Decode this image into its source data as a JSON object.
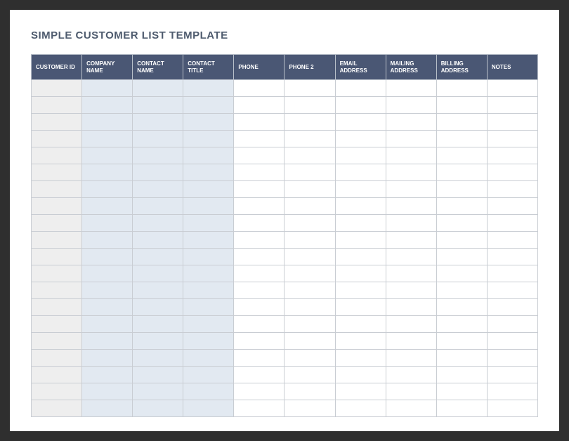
{
  "title": "SIMPLE CUSTOMER LIST TEMPLATE",
  "columns": [
    "CUSTOMER ID",
    "COMPANY NAME",
    "CONTACT NAME",
    "CONTACT TITLE",
    "PHONE",
    "PHONE 2",
    "EMAIL ADDRESS",
    "MAILING ADDRESS",
    "BILLING ADDRESS",
    "NOTES"
  ],
  "row_count": 20,
  "colors": {
    "header_bg": "#4a5774",
    "id_col_bg": "#eeeeee",
    "shaded_col_bg": "#e2e9f1",
    "page_frame": "#2f2f2f"
  }
}
